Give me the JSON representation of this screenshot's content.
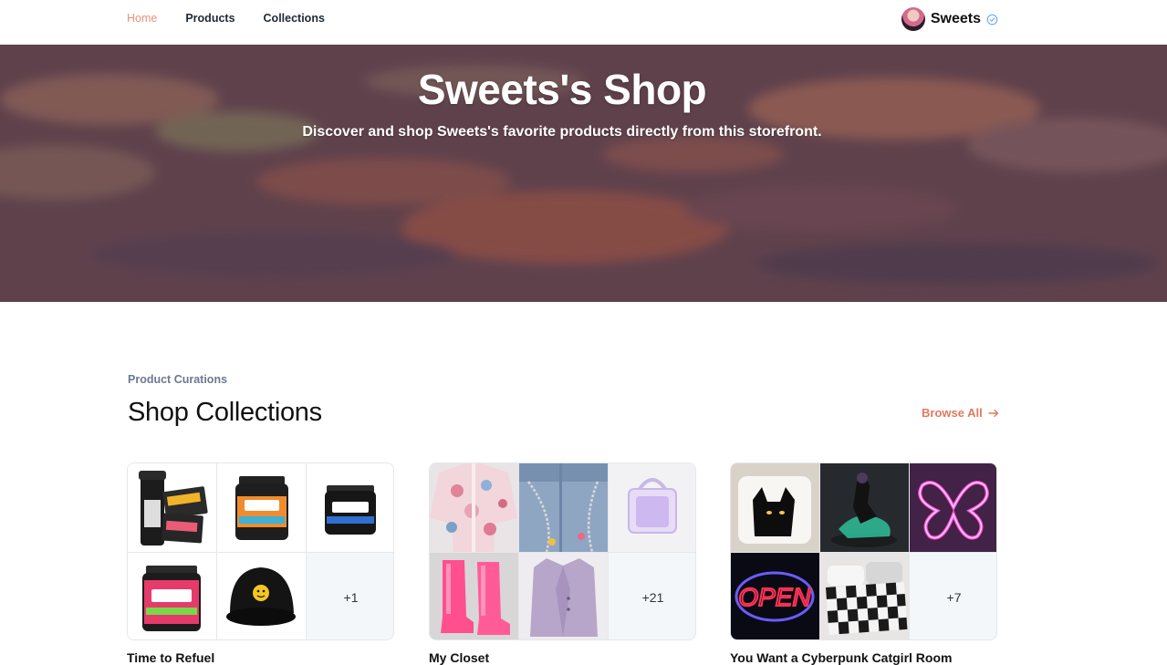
{
  "nav": {
    "links": [
      "Home",
      "Products",
      "Collections"
    ],
    "active": "Home"
  },
  "brand": {
    "name": "Sweets",
    "verified_icon": "check-circle-icon"
  },
  "hero": {
    "title": "Sweets's Shop",
    "subtitle": "Discover and shop Sweets's favorite products directly from this storefront."
  },
  "section": {
    "eyebrow": "Product Curations",
    "title": "Shop Collections",
    "browse_label": "Browse All",
    "browse_icon": "arrow-right-icon"
  },
  "collections": [
    {
      "name": "Time to Refuel",
      "more": "+1",
      "thumbs": [
        "shaker-and-packets",
        "dubby-tub-orange",
        "dubby-tub-blue",
        "dubby-tub-red",
        "black-cap"
      ]
    },
    {
      "name": "My Closet",
      "more": "+21",
      "thumbs": [
        "floral-kimono",
        "chain-jeans",
        "clear-purple-bag",
        "pink-boots",
        "lavender-coat"
      ]
    },
    {
      "name": "You Want a Cyberpunk Catgirl Room",
      "more": "+7",
      "thumbs": [
        "cat-pillow",
        "figure-statue",
        "neon-butterfly",
        "neon-open-sign",
        "checker-bedding"
      ]
    }
  ],
  "colors": {
    "accent": "#e07a5f",
    "nav_active": "#e8927c",
    "eyebrow": "#6b7a90"
  }
}
